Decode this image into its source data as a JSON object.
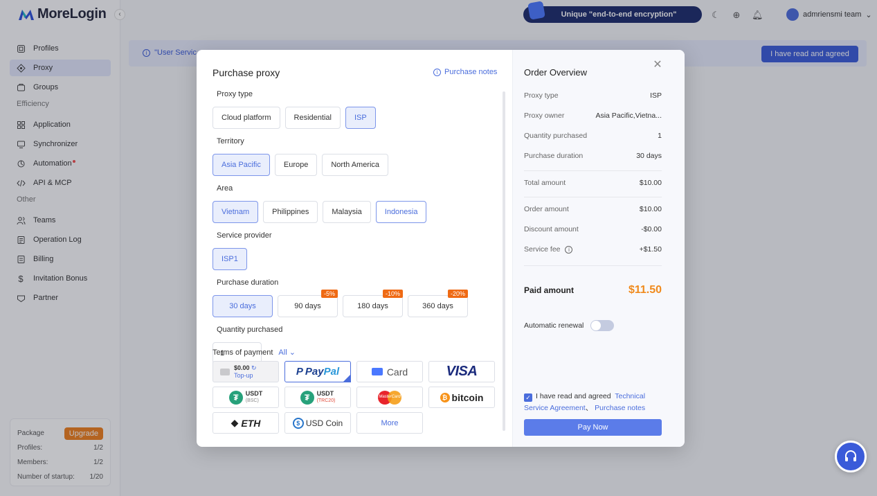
{
  "app": {
    "brand": "MoreLogin",
    "promo": "Unique \"end-to-end encryption\"",
    "user": "admriensmi team",
    "notice": "\"User Servic",
    "agree_top": "I have read and agreed"
  },
  "sidebar": {
    "items": [
      {
        "label": "Profiles",
        "icon": "profiles-icon"
      },
      {
        "label": "Proxy",
        "icon": "proxy-icon"
      },
      {
        "label": "Groups",
        "icon": "groups-icon"
      }
    ],
    "group_efficiency": "Efficiency",
    "efficiency_items": [
      {
        "label": "Application",
        "icon": "application-icon"
      },
      {
        "label": "Synchronizer",
        "icon": "synchronizer-icon"
      },
      {
        "label": "Automation",
        "icon": "automation-icon"
      },
      {
        "label": "API & MCP",
        "icon": "code-icon"
      }
    ],
    "group_other": "Other",
    "other_items": [
      {
        "label": "Teams",
        "icon": "teams-icon"
      },
      {
        "label": "Operation Log",
        "icon": "log-icon"
      },
      {
        "label": "Billing",
        "icon": "billing-icon"
      },
      {
        "label": "Invitation Bonus",
        "icon": "dollar-icon"
      },
      {
        "label": "Partner",
        "icon": "partner-icon"
      }
    ],
    "package": {
      "label": "Package",
      "upgrade": "Upgrade",
      "rows": [
        {
          "k": "Profiles:",
          "v": "1/2"
        },
        {
          "k": "Members:",
          "v": "1/2"
        },
        {
          "k": "Number of startup:",
          "v": "1/20"
        }
      ]
    }
  },
  "modal": {
    "title": "Purchase proxy",
    "notes_link": "Purchase notes",
    "proxy_type": {
      "label": "Proxy type",
      "options": [
        "Cloud platform",
        "Residential",
        "ISP"
      ],
      "selected": 2
    },
    "territory": {
      "label": "Territory",
      "options": [
        "Asia Pacific",
        "Europe",
        "North America"
      ],
      "selected": 0
    },
    "area": {
      "label": "Area",
      "options": [
        "Vietnam",
        "Philippines",
        "Malaysia",
        "Indonesia"
      ],
      "selected": 0
    },
    "provider": {
      "label": "Service provider",
      "options": [
        "ISP1"
      ]
    },
    "duration": {
      "label": "Purchase duration",
      "options": [
        {
          "label": "30 days",
          "discount": ""
        },
        {
          "label": "90 days",
          "discount": "-5%"
        },
        {
          "label": "180 days",
          "discount": "-10%"
        },
        {
          "label": "360 days",
          "discount": "-20%"
        }
      ]
    },
    "quantity": {
      "label": "Quantity purchased",
      "value": "1"
    },
    "terms": {
      "label": "Terms of payment",
      "filter": "All"
    },
    "payment": {
      "topup_amount": "$0.00",
      "topup_link": "Top-up",
      "paypal_a": "Pay",
      "paypal_b": "Pal",
      "card": "Card",
      "visa": "VISA",
      "usdt": "USDT",
      "bsc": "(BSC)",
      "trc20": "(TRC20)",
      "mastercard": "MasterCard",
      "bitcoin": "bitcoin",
      "eth": "ETH",
      "usdc": "USD Coin",
      "more": "More"
    }
  },
  "overview": {
    "title": "Order Overview",
    "rows": [
      {
        "k": "Proxy type",
        "v": "ISP"
      },
      {
        "k": "Proxy owner",
        "v": "Asia Pacific,Vietna..."
      },
      {
        "k": "Quantity purchased",
        "v": "1"
      },
      {
        "k": "Purchase duration",
        "v": "30 days"
      }
    ],
    "total": {
      "k": "Total amount",
      "v": "$10.00"
    },
    "rows2": [
      {
        "k": "Order amount",
        "v": "$10.00"
      },
      {
        "k": "Discount amount",
        "v": "-$0.00"
      },
      {
        "k": "Service fee",
        "v": "+$1.50"
      }
    ],
    "paid": {
      "k": "Paid amount",
      "v": "$11.50"
    },
    "renewal": "Automatic renewal",
    "agree_a": "I have read and agreed",
    "agree_link1": "Technical Service Agreement",
    "agree_sep": "、",
    "agree_link2": "Purchase notes",
    "pay_now": "Pay Now"
  },
  "colors": {
    "accent": "#4a6ddc",
    "paid": "#f08a1c",
    "upgrade": "#ef7e1c",
    "discount": "#ef6a14"
  }
}
